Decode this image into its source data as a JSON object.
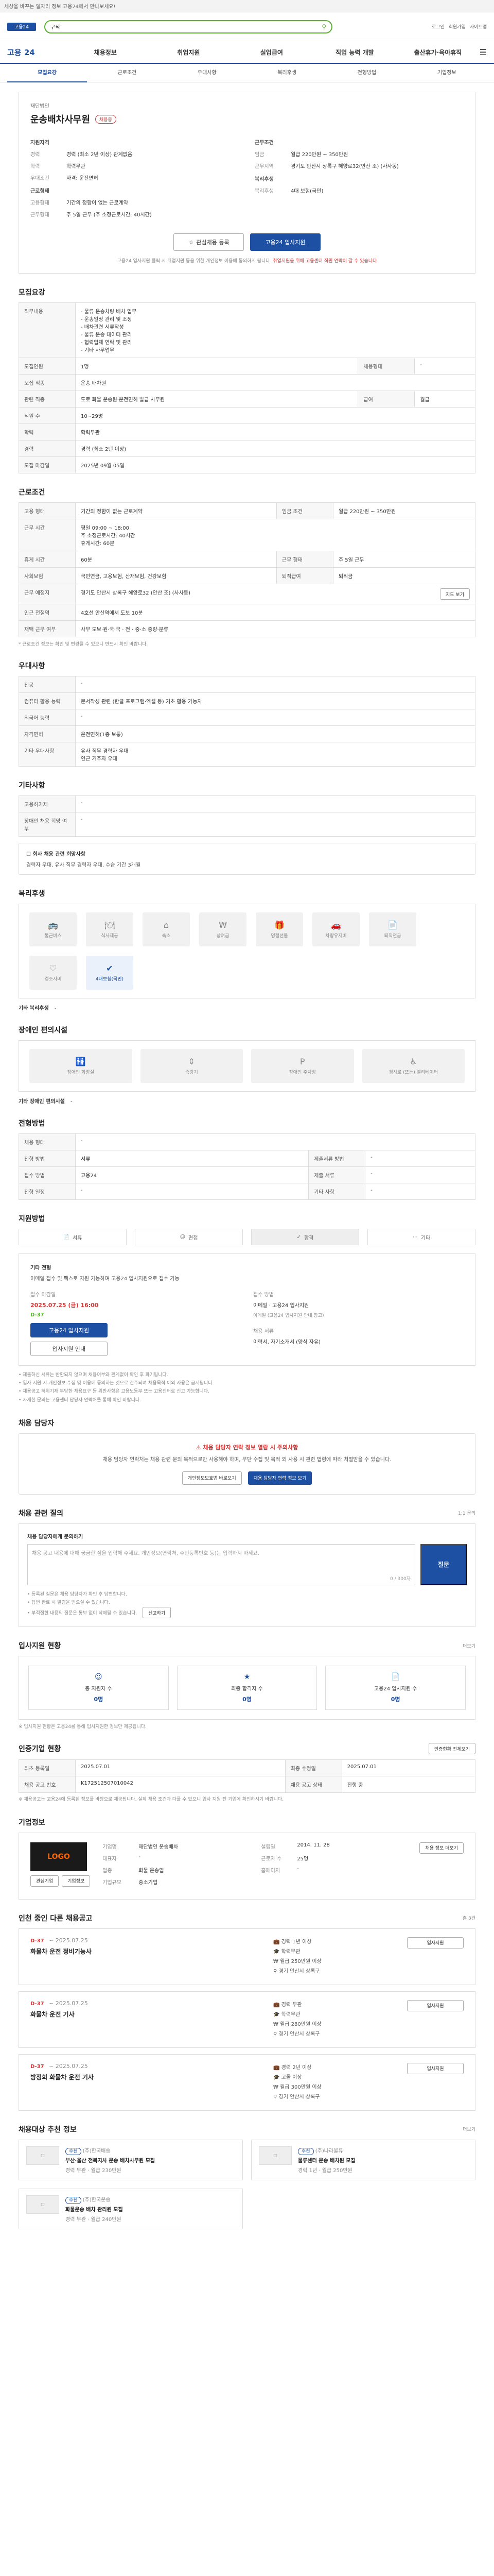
{
  "notice": {
    "text": "세상을 바꾸는 일자리 정보 고용24에서 만나보세요!"
  },
  "topbar": {
    "logo": "고용24",
    "search_placeholder": "검색어를 입력하세요",
    "search_value": "구직",
    "links": [
      "로그인",
      "회원가입",
      "사이트맵"
    ]
  },
  "gnb": {
    "brand": "고용 24",
    "menus": [
      "채용정보",
      "취업지원",
      "실업급여",
      "직업 능력 개발",
      "출산휴가·육아휴직"
    ]
  },
  "tabs": [
    {
      "label": "모집요강",
      "active": true
    },
    {
      "label": "근로조건",
      "active": false
    },
    {
      "label": "우대사항",
      "active": false
    },
    {
      "label": "복리후생",
      "active": false
    },
    {
      "label": "전형방법",
      "active": false
    },
    {
      "label": "기업정보",
      "active": false
    }
  ],
  "job": {
    "company": "재단법인",
    "title": "운송배차사무원",
    "badge": "채용중",
    "left_heading": "지원자격",
    "left_rows": [
      {
        "k": "경력",
        "v": "경력 (최소 2년 이상) 관계없음"
      },
      {
        "k": "학력",
        "v": "학력무관"
      },
      {
        "k": "우대조건",
        "v": "자격: 운전면허"
      }
    ],
    "left_heading2": "근로형태",
    "left_rows2": [
      {
        "k": "고용형태",
        "v": "기간의 정함이 없는 근로계약"
      },
      {
        "k": "근무형태",
        "v": "주 5일 근무 (주 소정근로시간: 40시간)"
      }
    ],
    "right_heading": "근무조건",
    "right_rows": [
      {
        "k": "임금",
        "v": "월급 220만원 ~ 350만원"
      },
      {
        "k": "근무지역",
        "v": "경기도 안산시 상록구 해양로32(안산 조) (사사동)"
      }
    ],
    "right_heading2": "복리후생",
    "right_rows2": [
      {
        "k": "복리후생",
        "v": "4대 보험(국민)"
      }
    ],
    "btn_interest": "관심채용 등록",
    "btn_apply": "고용24 입사지원",
    "note": "고용24 입사지원 클릭 시 취업지원 등을 위한 개인정보 이용에 동의하게 됩니다.",
    "note_red": "취업지원을 위해 고용센터 직원 연락이 갈 수 있습니다"
  },
  "recruit": {
    "title": "모집요강",
    "rows": [
      {
        "k": "직무내용",
        "v": "- 물류 운송차량 배차 업무\n- 운송일정 관리 및 조정\n- 배차관련 서류작성\n- 물류 운송 데이터 관리\n- 협력업체 연락 및 관리\n- 기타 사무업무"
      },
      {
        "k": "모집인원",
        "v": "1명"
      },
      {
        "k": "모집 직종",
        "v": "운송 배차원"
      },
      {
        "k": "관련 직종",
        "v": "도로 화물 운송원·운전면허 발급 사무원"
      },
      {
        "k": "직원 수",
        "v": "10~29명"
      },
      {
        "k": "학력",
        "v": "학력무관"
      },
      {
        "k": "경력",
        "v": "경력 (최소 2년 이상)"
      },
      {
        "k": "모집 마감일",
        "v": "2025년 09월 05일"
      }
    ],
    "hire_type_label": "채용형태",
    "hire_type": "-",
    "pay_label": "급여",
    "pay": "월급"
  },
  "conditions": {
    "title": "근로조건",
    "rows": [
      {
        "k": "고용 형태",
        "v": "기간의 정함이 없는 근로계약",
        "k2": "임금 조건",
        "v2": "월급 220만원 ~ 350만원"
      },
      {
        "k": "근무 시간",
        "v": "평일 09:00 ~ 18:00\n주 소정근로시간: 40시간\n휴게시간: 60분",
        "k2": "",
        "v2": ""
      },
      {
        "k": "휴게 시간",
        "v": "60분",
        "k2": "근무 형태",
        "v2": "주 5일 근무"
      },
      {
        "k": "사회보험",
        "v": "국민연금, 고용보험, 산재보험, 건강보험",
        "k2": "퇴직급여",
        "v2": "퇴직금"
      },
      {
        "k": "근무 예정지",
        "v": "경기도 안산시 상록구 해양로32 (안산 조) (사사동)",
        "k2": "",
        "v2": ""
      },
      {
        "k": "인근 전철역",
        "v": "4호선 안산역에서 도보 10분",
        "k2": "",
        "v2": ""
      },
      {
        "k": "재택 근무 여부",
        "v": "사무 도보·원·국·국 · 전 · 중·소 중량·분류",
        "k2": "",
        "v2": ""
      }
    ],
    "map_btn": "지도 보기",
    "footnote": "* 근로조건 정보는 확인 및 변경될 수 있으니 반드시 확인 바랍니다."
  },
  "preferences": {
    "title": "우대사항",
    "rows": [
      {
        "k": "전공",
        "v": "-"
      },
      {
        "k": "컴퓨터 활용 능력",
        "v": "문서작성 관련 (한글 프로그램·엑셀 등) 기초 활용 가능자"
      },
      {
        "k": "외국어 능력",
        "v": "-"
      },
      {
        "k": "자격면허",
        "v": "운전면허(1종 보통)"
      },
      {
        "k": "기타 우대사항",
        "v": "유사 직무 경력자 우대\n인근 거주자 우대"
      }
    ]
  },
  "other": {
    "title": "기타사항",
    "rows": [
      {
        "k": "고용허가제",
        "v": "-"
      },
      {
        "k": "장애인 채용 희망 여부",
        "v": "-"
      }
    ],
    "box_title": "☐ 회사 채용 관련 희망사항",
    "box_body": "경력자 우대, 유사 직무 경력자 우대, 수습 기간 3개월"
  },
  "benefits": {
    "title": "복리후생",
    "items": [
      {
        "icon": "bus-icon",
        "label": "통근버스",
        "on": false
      },
      {
        "icon": "meal-icon",
        "label": "식사제공",
        "on": false
      },
      {
        "icon": "house-icon",
        "label": "숙소",
        "on": false
      },
      {
        "icon": "money-icon",
        "label": "상여금",
        "on": false
      },
      {
        "icon": "gift-icon",
        "label": "명절선물",
        "on": false
      },
      {
        "icon": "car-icon",
        "label": "차량유지비",
        "on": false
      },
      {
        "icon": "doc-icon",
        "label": "퇴직연금",
        "on": false
      },
      {
        "icon": "heart-icon",
        "label": "경조사비",
        "on": false
      },
      {
        "icon": "check-icon",
        "label": "4대보험(국민)",
        "on": true
      }
    ],
    "extra_label": "기타 복리후생",
    "extra_value": "-"
  },
  "disability": {
    "title": "장애인 편의시설",
    "items": [
      "장애인 화장실",
      "승강기",
      "장애인 주차장",
      "경사로 (또는) 엘리베이터"
    ],
    "extra_label": "기타 장애인 편의시설",
    "extra_value": "-"
  },
  "screening": {
    "title": "전형방법",
    "rows": [
      {
        "k": "채용 형태",
        "v": "-"
      },
      {
        "k": "전형 방법",
        "v": "서류",
        "k2": "제출서류 방법",
        "v2": "-"
      },
      {
        "k": "접수 방법",
        "v": "고용24",
        "k2": "제출 서류",
        "v2": "-"
      },
      {
        "k": "전형 일정",
        "v": "-",
        "k2": "기타 사항",
        "v2": "-"
      }
    ]
  },
  "apply": {
    "title": "지원방법",
    "steps": [
      {
        "label": "서류",
        "on": false
      },
      {
        "label": "면접",
        "on": false
      },
      {
        "label": "합격",
        "on": true
      },
      {
        "label": "기타",
        "on": false
      }
    ],
    "box_label": "기타 전형",
    "box_text": "이메일 접수 및 팩스로 지원 가능하며 고용24 입사지원으로 접수 가능",
    "col1_label": "접수 마감일",
    "col1_date": "2025.07.25 (금) 16:00",
    "col1_dday": "D-37",
    "col1_btn": "고용24 입사지원",
    "col1_btn2": "입사지원 안내",
    "col2_label": "접수 방법",
    "col2_value": "이메일 · 고용24 입사지원",
    "col2_sub": "이메일 (고용24 입사지원 안내 참고)",
    "col3_label": "채용 서류",
    "col3_value": "이력서, 자기소개서 (양식 자유)",
    "notes": [
      "• 제출하신 서류는 반환되지 않으며 채용여부와 관계없이 확인 후 파기됩니다.",
      "• 입사 지원 시 개인정보 수집 및 이용에 동의하는 것으로 간주되며 채용목적 이외 사용은 금지됩니다.",
      "• 채용공고 허위기재·부당한 채용요구 등 위반사항은 고용노동부 또는 고용센터로 신고 가능합니다.",
      "• 자세한 문의는 고용센터 담당자 연락처를 통해 확인 바랍니다."
    ]
  },
  "hire_contact": {
    "title": "채용 담당자",
    "alert_title": "채용 담당자 연락 정보 열람 시 주의사항",
    "alert_body": "채용 담당자 연락처는 채용 관련 문의 목적으로만 사용해야 하며, 무단 수집 및 목적 외 사용 시 관련 법령에 따라 처벌받을 수 있습니다.",
    "btn1": "개인정보보호법 바로보기",
    "btn2": "채용 담당자 연락 정보 보기"
  },
  "question": {
    "title": "채용 관련 질의",
    "sub": "1:1 문의",
    "label": "채용 담당자에게 문의하기",
    "placeholder": "채용 공고 내용에 대해 궁금한 점을 입력해 주세요. 개인정보(연락처, 주민등록번호 등)는 입력하지 마세요.",
    "counter": "0 / 300자",
    "submit": "질문",
    "notes": [
      "• 등록된 질문은 채용 담당자가 확인 후 답변합니다.",
      "• 답변 완료 시 알림을 받으실 수 있습니다.",
      "• 부적절한 내용의 질문은 통보 없이 삭제될 수 있습니다."
    ],
    "report_btn": "신고하기"
  },
  "stats": {
    "title": "입사지원 현황",
    "more": "더보기",
    "items": [
      {
        "label": "총 지원자 수",
        "value": "0명"
      },
      {
        "label": "최종 합격자 수",
        "value": "0명"
      },
      {
        "label": "고용24 입사지원 수",
        "value": "0명"
      }
    ],
    "note": "※ 입사지원 현황은 고용24를 통해 입사지원한 정보만 제공됩니다."
  },
  "notice_info": {
    "title": "인증기업 현황",
    "more_btn": "인증현황 전체보기",
    "rows": [
      {
        "k": "최초 등록일",
        "v": "2025.07.01",
        "k2": "최종 수정일",
        "v2": "2025.07.01"
      },
      {
        "k": "채용 공고 번호",
        "v": "K172512507010042",
        "k2": "채용 공고 상태",
        "v2": "진행 중"
      }
    ],
    "footnote": "※ 채용공고는 고용24에 등록된 정보를 바탕으로 제공됩니다. 실제 채용 조건과 다를 수 있으니 입사 지원 전 기업에 확인하시기 바랍니다."
  },
  "company": {
    "title": "기업정보",
    "logo_text": "LOGO",
    "name": "재단법인 운송배차",
    "btn_interest": "관심기업",
    "btn_info": "기업정보",
    "rows": [
      {
        "k": "기업명",
        "v": "재단법인 운송배차"
      },
      {
        "k": "대표자",
        "v": "-"
      },
      {
        "k": "업종",
        "v": "화물 운송업"
      },
      {
        "k": "기업규모",
        "v": "중소기업"
      }
    ],
    "rows2": [
      {
        "k": "설립일",
        "v": "2014. 11. 28"
      },
      {
        "k": "근로자 수",
        "v": "25명"
      },
      {
        "k": "홈페이지",
        "v": "-"
      }
    ],
    "more_btn": "채용 정보 더보기"
  },
  "recent": {
    "title": "인천 중인 다른 채용공고",
    "more": "총 3건",
    "items": [
      {
        "dday": "D-37",
        "date": "~ 2025.07.25",
        "title": "화물차 운전 정비기능사",
        "c1": "경력 1년 이상",
        "c2": "학력무관",
        "c3": "월급 250만원 이상",
        "c4": "경기 안산시 상록구",
        "btn": "입사지원"
      },
      {
        "dday": "D-37",
        "date": "~ 2025.07.25",
        "title": "화물차 운전 기사",
        "c1": "경력 무관",
        "c2": "학력무관",
        "c3": "월급 280만원 이상",
        "c4": "경기 안산시 상록구",
        "btn": "입사지원"
      },
      {
        "dday": "D-37",
        "date": "~ 2025.07.25",
        "title": "방정회 화물차 운전 기사",
        "c1": "경력 2년 이상",
        "c2": "고졸 이상",
        "c3": "월급 300만원 이상",
        "c4": "경기 안산시 상록구",
        "btn": "입사지원"
      }
    ]
  },
  "related": {
    "title": "채용대상 추천 정보",
    "more": "더보기",
    "cards": [
      {
        "tag": "추천",
        "company": "(주)한국배송",
        "title": "부산·울산 전북지사 운송 배차사무원 모집",
        "meta": "경력 무관 · 월급 230만원"
      },
      {
        "tag": "추천",
        "company": "(주)나라물류",
        "title": "물류센터 운송 배차원 모집",
        "meta": "경력 1년 · 월급 250만원"
      },
      {
        "tag": "추천",
        "company": "(주)한국운송",
        "title": "화물운송 배차 관리원 모집",
        "meta": "경력 무관 · 월급 240만원"
      }
    ]
  }
}
